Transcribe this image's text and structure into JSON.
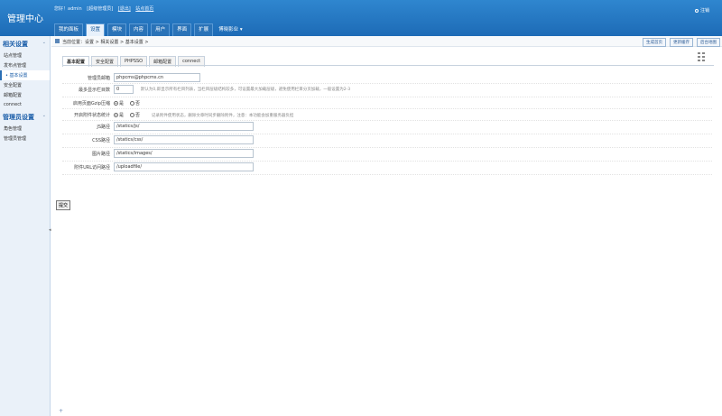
{
  "header": {
    "logo": "管理中心",
    "greeting": "您好！admin",
    "role": "[超级管理员]",
    "logout_link": "[退出]",
    "site_home": "站点首页",
    "logout_right": "注销",
    "nav": [
      "我的面板",
      "设置",
      "模块",
      "内容",
      "用户",
      "界面",
      "扩展"
    ],
    "nav_active": "设置",
    "nav_more": "博晓影业 ▾"
  },
  "sidebar": {
    "sections": [
      {
        "title": "相关设置",
        "items": [
          "站点管理",
          "发布点管理",
          "• 基本设置",
          "安全配置",
          "邮箱配置",
          "connect"
        ]
      },
      {
        "title": "管理员设置",
        "items": [
          "角色管理",
          "管理员管理"
        ]
      }
    ],
    "active_item": "• 基本设置"
  },
  "crumb": {
    "text": "当前位置：设置 > 相关设置 > 基本设置 >",
    "buttons": [
      "生成首页",
      "更新缓存",
      "后台地图"
    ]
  },
  "tabs": [
    "基本配置",
    "安全配置",
    "PHPSSO",
    "邮箱配置",
    "connect"
  ],
  "active_tab": "基本配置",
  "form": {
    "admin_email_label": "管理员邮箱",
    "admin_email_value": "phpcms@phpcms.cn",
    "list_max_label": "最多显示栏目数",
    "list_max_value": "0",
    "list_max_hint": "默认为0,即显示所有栏目列表，当栏目层级结构较多，可设置最大加载层级，避免使用栏目分页加载，一般设置为2-3",
    "gzip_label": "启用页面Gzip压缩",
    "attachment_stat_label": "开启附件状态统计",
    "attachment_stat_hint": "记录附件使用状态，删除文章时同步删除附件，注意：本功能会加重服务器负担",
    "yes": "是",
    "no": "否",
    "js_label": "JS路径",
    "js_value": "/statics/js/",
    "css_label": "CSS路径",
    "css_value": "/statics/css/",
    "img_label": "图片路径",
    "img_value": "/statics/images/",
    "upload_label": "附件URL访问路径",
    "upload_value": "/uploadfile/",
    "submit": "提交"
  }
}
